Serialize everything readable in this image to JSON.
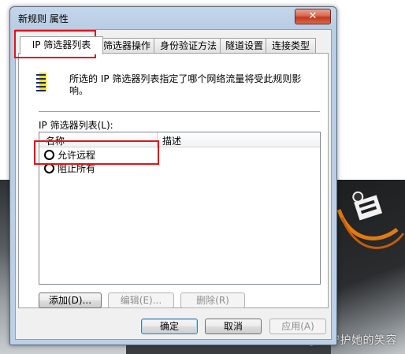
{
  "window": {
    "title": "新规则 属性",
    "close_symbol": "✕"
  },
  "tabs": [
    {
      "label": "IP 筛选器列表",
      "active": true
    },
    {
      "label": "筛选器操作",
      "active": false
    },
    {
      "label": "身份验证方法",
      "active": false
    },
    {
      "label": "隧道设置",
      "active": false
    },
    {
      "label": "连接类型",
      "active": false
    }
  ],
  "panel": {
    "icon": "filter-list-icon",
    "description": "所选的 IP 筛选器列表指定了哪个网络流量将受此规则影响。",
    "list_label": "IP 筛选器列表(L):",
    "columns": [
      "名称",
      "描述"
    ],
    "items": [
      {
        "name": "允许远程",
        "description": "",
        "selected": false
      },
      {
        "name": "阻止所有",
        "description": "",
        "selected": false
      }
    ],
    "add_button": "添加(D)...",
    "edit_button": "编辑(E)...",
    "delete_button": "删除(R)"
  },
  "footer": {
    "ok_button": "确定",
    "cancel_button": "取消",
    "apply_button": "应用(A)"
  },
  "background": {
    "watermark": "CSDN @不守护她的笑容"
  },
  "colors": {
    "highlight_box": "#e0141a",
    "title_bar": "#bcd0e6",
    "close_button": "#c2381c"
  }
}
